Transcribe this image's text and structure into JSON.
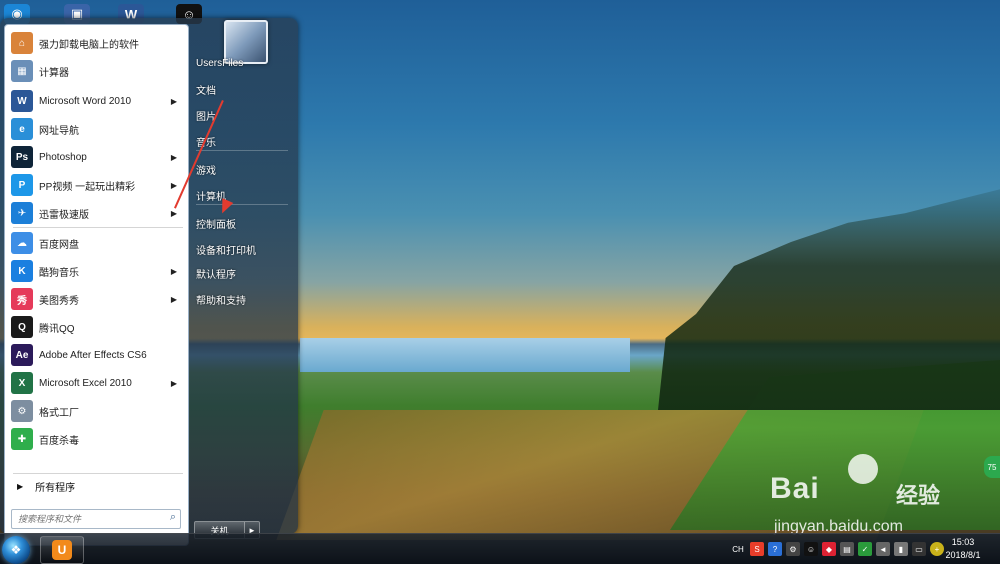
{
  "start_menu": {
    "left_items": [
      {
        "label": "强力卸载电脑上的软件",
        "icon": "uninstall-icon",
        "color": "#d9833a",
        "glyph": "⌂",
        "has_submenu": false
      },
      {
        "label": "计算器",
        "icon": "calculator-icon",
        "color": "#6a8fb8",
        "glyph": "▦",
        "has_submenu": false
      },
      {
        "label": "Microsoft Word 2010",
        "icon": "word-icon",
        "color": "#2b5797",
        "glyph": "W",
        "has_submenu": true
      },
      {
        "label": "网址导航",
        "icon": "ie-icon",
        "color": "#2a8fd8",
        "glyph": "e",
        "has_submenu": false
      },
      {
        "label": "Photoshop",
        "icon": "photoshop-icon",
        "color": "#0e2438",
        "glyph": "Ps",
        "has_submenu": true
      },
      {
        "label": "PP视频 一起玩出精彩",
        "icon": "pp-video-icon",
        "color": "#1d97e8",
        "glyph": "P",
        "has_submenu": true
      },
      {
        "label": "迅雷极速版",
        "icon": "xunlei-icon",
        "color": "#1c7fd8",
        "glyph": "✈",
        "has_submenu": true
      },
      {
        "label": "百度网盘",
        "icon": "baidu-netdisk-icon",
        "color": "#3d8ee6",
        "glyph": "☁",
        "has_submenu": false
      },
      {
        "label": "酷狗音乐",
        "icon": "kugou-icon",
        "color": "#1a7fe0",
        "glyph": "K",
        "has_submenu": true
      },
      {
        "label": "美图秀秀",
        "icon": "meitu-icon",
        "color": "#e53a5a",
        "glyph": "秀",
        "has_submenu": true
      },
      {
        "label": "腾讯QQ",
        "icon": "qq-icon",
        "color": "#1a1a1a",
        "glyph": "Q",
        "has_submenu": false
      },
      {
        "label": "Adobe After Effects CS6",
        "icon": "after-effects-icon",
        "color": "#2b1a5a",
        "glyph": "Ae",
        "has_submenu": false
      },
      {
        "label": "Microsoft Excel 2010",
        "icon": "excel-icon",
        "color": "#217346",
        "glyph": "X",
        "has_submenu": true
      },
      {
        "label": "格式工厂",
        "icon": "format-factory-icon",
        "color": "#7d8ea0",
        "glyph": "⚙",
        "has_submenu": false
      },
      {
        "label": "百度杀毒",
        "icon": "baidu-antivirus-icon",
        "color": "#2fae4c",
        "glyph": "✚",
        "has_submenu": false
      }
    ],
    "all_programs": "所有程序",
    "search_placeholder": "搜索程序和文件",
    "right_items": [
      {
        "label": "UsersFiles",
        "name": "right-item-usersfiles"
      },
      {
        "label": "文档",
        "name": "right-item-documents"
      },
      {
        "label": "图片",
        "name": "right-item-pictures"
      },
      {
        "label": "音乐",
        "name": "right-item-music"
      },
      {
        "label": "游戏",
        "name": "right-item-games"
      },
      {
        "label": "计算机",
        "name": "right-item-computer"
      },
      {
        "label": "控制面板",
        "name": "right-item-control-panel"
      },
      {
        "label": "设备和打印机",
        "name": "right-item-devices-printers"
      },
      {
        "label": "默认程序",
        "name": "right-item-default-programs"
      },
      {
        "label": "帮助和支持",
        "name": "right-item-help-support"
      }
    ],
    "shutdown_label": "关机"
  },
  "taskbar": {
    "ime": "CH",
    "time": "15:03",
    "date": "2018/8/1"
  },
  "watermark": {
    "brand": "Bai",
    "brand2": "经验",
    "url": "jingyan.baidu.com"
  },
  "colors": {
    "arrow": "#e23b2f",
    "menu_bg": "#ffffff"
  }
}
